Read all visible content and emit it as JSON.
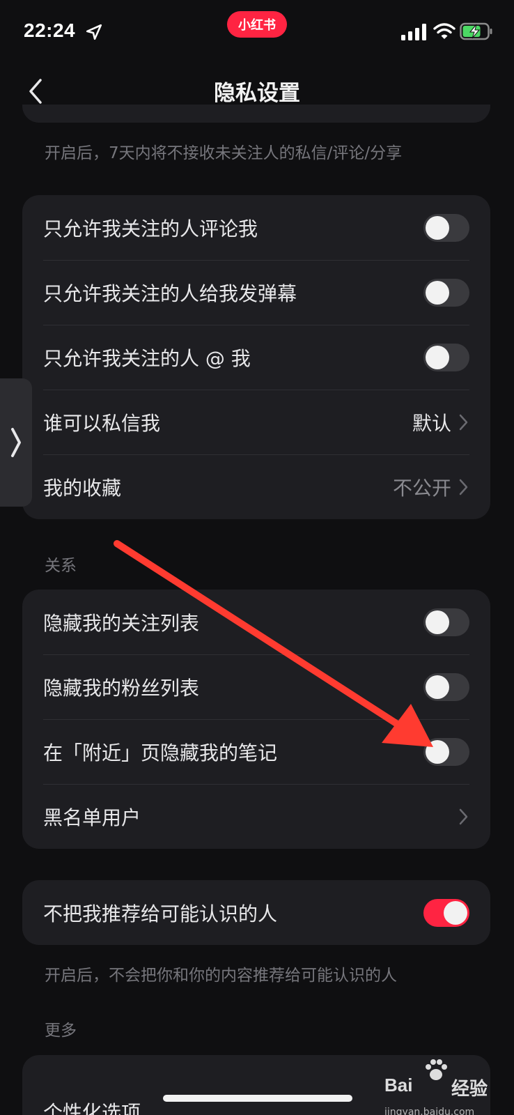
{
  "status_bar": {
    "time": "22:24",
    "brand_badge": "小红书"
  },
  "nav": {
    "title": "隐私设置"
  },
  "notes": {
    "top_note": "开启后，7天内将不接收未关注人的私信/评论/分享",
    "recommend_note": "开启后，不会把你和你的内容推荐给可能认识的人"
  },
  "interaction_card": {
    "rows": [
      {
        "label": "只允许我关注的人评论我",
        "toggle": false
      },
      {
        "label": "只允许我关注的人给我发弹幕",
        "toggle": false
      },
      {
        "label": "只允许我关注的人 @ 我",
        "toggle": false
      },
      {
        "label": "谁可以私信我",
        "value": "默认"
      },
      {
        "label": "我的收藏",
        "value": "不公开"
      }
    ]
  },
  "relations_section": {
    "header": "关系",
    "rows": [
      {
        "label": "隐藏我的关注列表",
        "toggle": false
      },
      {
        "label": "隐藏我的粉丝列表",
        "toggle": false
      },
      {
        "label": "在「附近」页隐藏我的笔记",
        "toggle": false
      },
      {
        "label": "黑名单用户"
      }
    ]
  },
  "recommend_card": {
    "label": "不把我推荐给可能认识的人",
    "toggle": true
  },
  "more_section": {
    "header": "更多",
    "rows": [
      {
        "label": "个性化选项"
      }
    ]
  },
  "watermark": {
    "text_left": "Bai",
    "text_right": "经验",
    "url": "jingyan.baidu.com"
  },
  "colors": {
    "background": "#0f0f11",
    "card": "#1e1e22",
    "accent": "#ff2442",
    "annotation_arrow": "#ff3b30"
  }
}
